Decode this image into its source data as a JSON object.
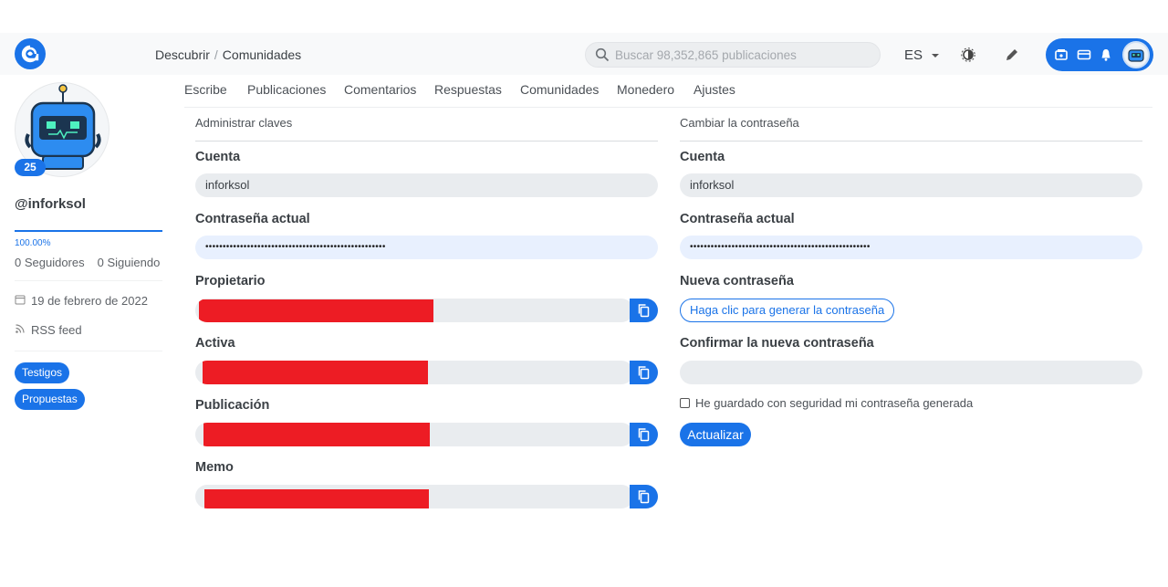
{
  "header": {
    "breadcrumb": [
      "Descubrir",
      "Comunidades"
    ],
    "breadcrumb_separator": "/",
    "search_placeholder": "Buscar 98,352,865 publicaciones",
    "language": "ES"
  },
  "profile": {
    "reputation": "25",
    "username": "@inforksol",
    "voting_power": "100.00%",
    "followers": "0 Seguidores",
    "following": "0 Siguiendo",
    "joined": "19 de febrero de 2022",
    "rss": "RSS feed",
    "buttons": [
      "Testigos",
      "Propuestas"
    ]
  },
  "tabs": [
    "Escribe",
    "Publicaciones",
    "Comentarios",
    "Respuestas",
    "Comunidades",
    "Monedero",
    "Ajustes"
  ],
  "manage_keys": {
    "title": "Administrar claves",
    "account_label": "Cuenta",
    "account_value": "inforksol",
    "current_password_label": "Contraseña actual",
    "current_password_value": "••••••••••••••••••••••••••••••••••••••••••••••••••••",
    "keys": [
      {
        "label": "Propietario",
        "redacted_fraction": 0.5
      },
      {
        "label": "Activa",
        "redacted_fraction": 0.5
      },
      {
        "label": "Publicación",
        "redacted_fraction": 0.5
      },
      {
        "label": "Memo",
        "redacted_fraction": 0.5
      }
    ]
  },
  "change_password": {
    "title": "Cambiar la contraseña",
    "account_label": "Cuenta",
    "account_value": "inforksol",
    "current_password_label": "Contraseña actual",
    "current_password_value": "••••••••••••••••••••••••••••••••••••••••••••••••••••",
    "new_password_label": "Nueva contraseña",
    "generate_button": "Haga clic para generar la contraseña",
    "confirm_label": "Confirmar la nueva contraseña",
    "confirm_value": "",
    "saved_checkbox": "He guardado con seguridad mi contraseña generada",
    "update_button": "Actualizar"
  },
  "colors": {
    "accent": "#1a73e8",
    "redaction": "#ed1c24"
  }
}
